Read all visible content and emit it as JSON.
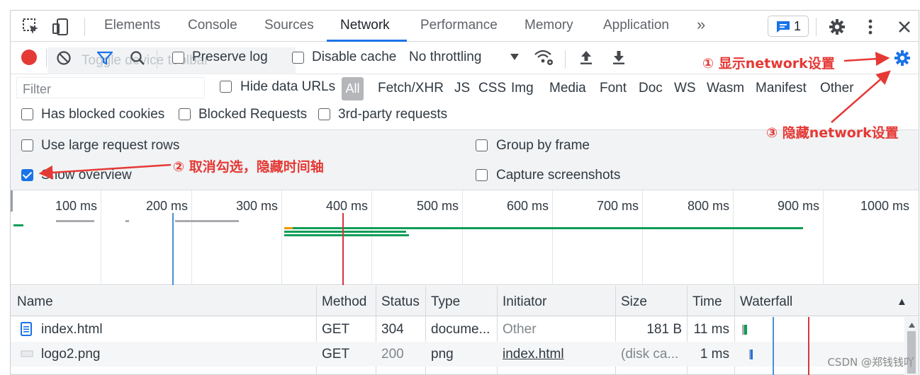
{
  "tabs": [
    "Elements",
    "Console",
    "Sources",
    "Network",
    "Performance",
    "Memory",
    "Application"
  ],
  "active_tab": "Network",
  "more_tabs_label": "»",
  "issues_count": "1",
  "toolbar": {
    "tooltip_text": "Toggle device toolbar",
    "preserve_log": "Preserve log",
    "disable_cache": "Disable cache",
    "throttling": "No throttling"
  },
  "filter": {
    "placeholder": "Filter",
    "hide_data_urls": "Hide data URLs",
    "types": [
      "All",
      "Fetch/XHR",
      "JS",
      "CSS",
      "Img",
      "Media",
      "Font",
      "Doc",
      "WS",
      "Wasm",
      "Manifest",
      "Other"
    ],
    "has_blocked_cookies": "Has blocked cookies",
    "blocked_requests": "Blocked Requests",
    "third_party": "3rd-party requests"
  },
  "settings": {
    "large_rows": "Use large request rows",
    "show_overview": "Show overview",
    "show_overview_checked": true,
    "group_by_frame": "Group by frame",
    "capture_screenshots": "Capture screenshots"
  },
  "overview": {
    "ticks": [
      "100 ms",
      "200 ms",
      "300 ms",
      "400 ms",
      "500 ms",
      "600 ms",
      "700 ms",
      "800 ms",
      "900 ms",
      "1000 ms"
    ]
  },
  "table": {
    "columns": [
      "Name",
      "Method",
      "Status",
      "Type",
      "Initiator",
      "Size",
      "Time",
      "Waterfall"
    ],
    "sort_indicator": "▲",
    "rows": [
      {
        "name": "index.html",
        "method": "GET",
        "status": "304",
        "type": "docume...",
        "initiator": "Other",
        "size": "181 B",
        "time": "11 ms"
      },
      {
        "name": "logo2.png",
        "method": "GET",
        "status": "200",
        "type": "png",
        "initiator": "index.html",
        "size": "(disk ca...",
        "time": "1 ms"
      }
    ]
  },
  "annotations": {
    "a1": "① 显示network设置",
    "a2": "② 取消勾选，隐藏时间轴",
    "a3": "③ 隐藏network设置"
  },
  "watermark": "CSDN @郑钱钱吖",
  "colors": {
    "accent": "#1a73e8",
    "annotation": "#e53935",
    "record": "#e53935",
    "bar_green": "#0f9d58"
  }
}
